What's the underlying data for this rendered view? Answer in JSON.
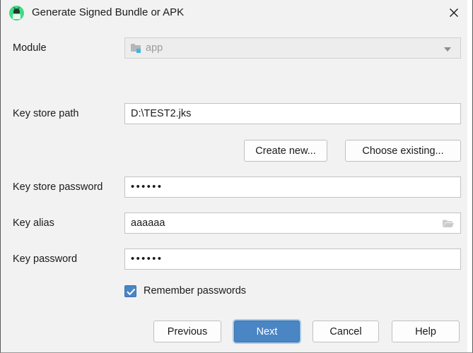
{
  "window": {
    "title": "Generate Signed Bundle or APK",
    "app_icon": "android-studio-icon",
    "close_icon": "close-icon",
    "accent_color": "#4a85c4",
    "background_color": "#f2f2f2"
  },
  "form": {
    "module": {
      "label": "Module",
      "value": "app",
      "icon": "module-folder-icon",
      "dropdown_icon": "chevron-down-icon",
      "disabled": true
    },
    "key_store_path": {
      "label": "Key store path",
      "value": "D:\\TEST2.jks",
      "placeholder": ""
    },
    "key_store_actions": {
      "create_new": "Create new...",
      "choose_existing": "Choose existing..."
    },
    "key_store_password": {
      "label": "Key store password",
      "value": "••••••",
      "masked": true,
      "length": 6
    },
    "key_alias": {
      "label": "Key alias",
      "value": "aaaaaa",
      "browse_icon": "folder-open-icon"
    },
    "key_password": {
      "label": "Key password",
      "value": "••••••",
      "masked": true,
      "length": 6
    },
    "remember_passwords": {
      "label": "Remember passwords",
      "checked": true
    }
  },
  "footer": {
    "previous": "Previous",
    "next": "Next",
    "cancel": "Cancel",
    "help": "Help"
  }
}
